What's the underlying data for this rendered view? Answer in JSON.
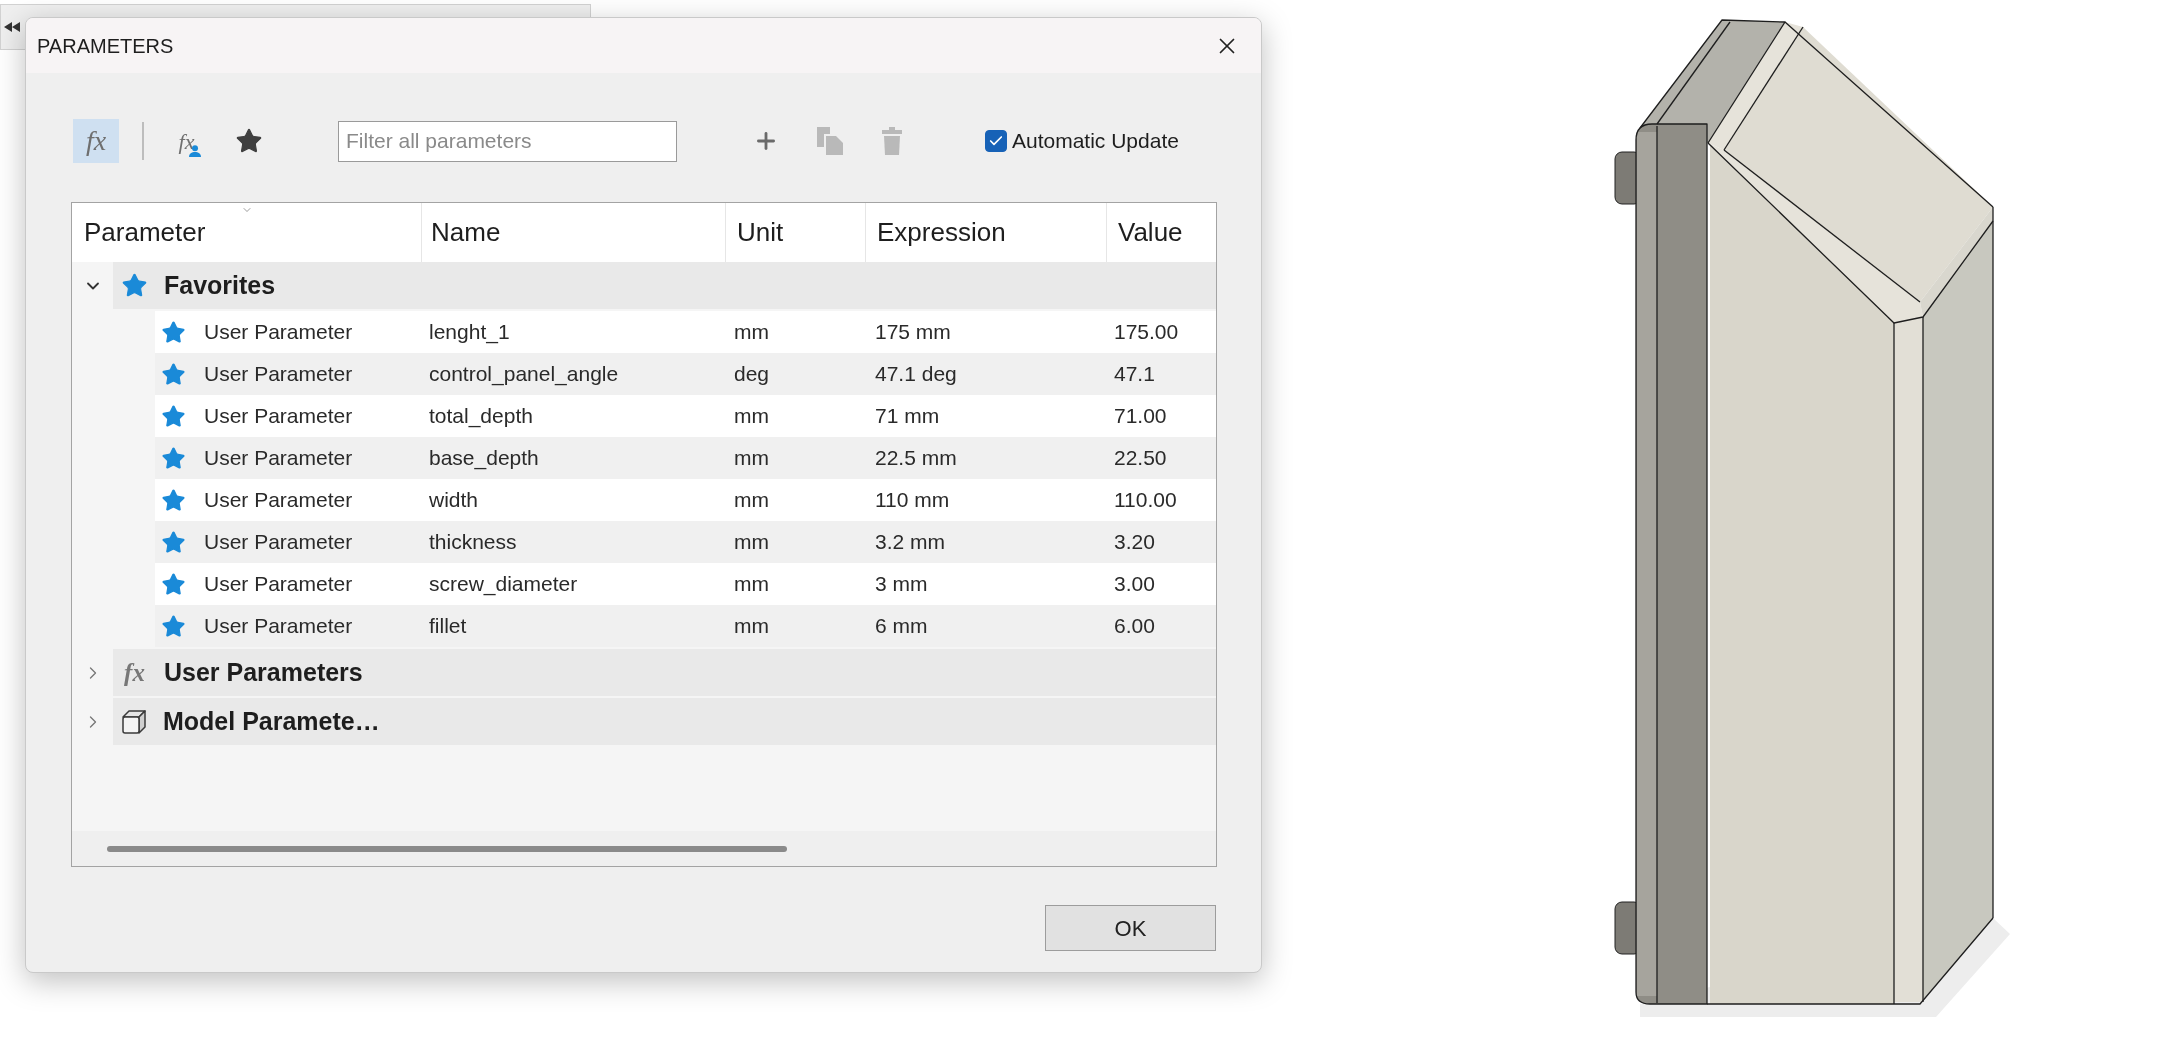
{
  "dialog": {
    "title": "PARAMETERS"
  },
  "toolbar": {
    "views": [
      {
        "kind": "all",
        "symbol": "fx",
        "selected": true
      },
      {
        "kind": "user",
        "symbol": "fx",
        "selected": false
      },
      {
        "kind": "favorites",
        "selected": false
      }
    ],
    "filter": {
      "placeholder": "Filter all parameters"
    },
    "actions": [
      {
        "kind": "add",
        "disabled": false
      },
      {
        "kind": "copy",
        "disabled": true
      },
      {
        "kind": "delete",
        "disabled": true
      }
    ],
    "automatic_update": {
      "label": "Automatic Update",
      "checked": true
    }
  },
  "table": {
    "columns": [
      {
        "label": "Parameter",
        "sorted": true
      },
      {
        "label": "Name",
        "sorted": false
      },
      {
        "label": "Unit",
        "sorted": false
      },
      {
        "label": "Expression",
        "sorted": false
      },
      {
        "label": "Value",
        "sorted": false
      }
    ],
    "groups": [
      {
        "kind": "favorites",
        "label": "Favorites",
        "expanded": true,
        "rows": [
          {
            "parameter": "User Parameter",
            "name": "lenght_1",
            "unit": "mm",
            "expression": "175 mm",
            "value": "175.00",
            "favorite": true
          },
          {
            "parameter": "User Parameter",
            "name": "control_panel_angle",
            "unit": "deg",
            "expression": "47.1 deg",
            "value": "47.1",
            "favorite": true
          },
          {
            "parameter": "User Parameter",
            "name": "total_depth",
            "unit": "mm",
            "expression": "71 mm",
            "value": "71.00",
            "favorite": true
          },
          {
            "parameter": "User Parameter",
            "name": "base_depth",
            "unit": "mm",
            "expression": "22.5 mm",
            "value": "22.50",
            "favorite": true
          },
          {
            "parameter": "User Parameter",
            "name": "width",
            "unit": "mm",
            "expression": "110 mm",
            "value": "110.00",
            "favorite": true
          },
          {
            "parameter": "User Parameter",
            "name": "thickness",
            "unit": "mm",
            "expression": "3.2 mm",
            "value": "3.20",
            "favorite": true
          },
          {
            "parameter": "User Parameter",
            "name": "screw_diameter",
            "unit": "mm",
            "expression": "3 mm",
            "value": "3.00",
            "favorite": true
          },
          {
            "parameter": "User Parameter",
            "name": "fillet",
            "unit": "mm",
            "expression": "6 mm",
            "value": "6.00",
            "favorite": true
          }
        ]
      },
      {
        "kind": "user",
        "symbol": "fx",
        "label": "User Parameters",
        "expanded": false
      },
      {
        "kind": "model",
        "label": "Model Paramete…",
        "expanded": false
      }
    ]
  },
  "buttons": [
    {
      "label": "OK"
    }
  ]
}
